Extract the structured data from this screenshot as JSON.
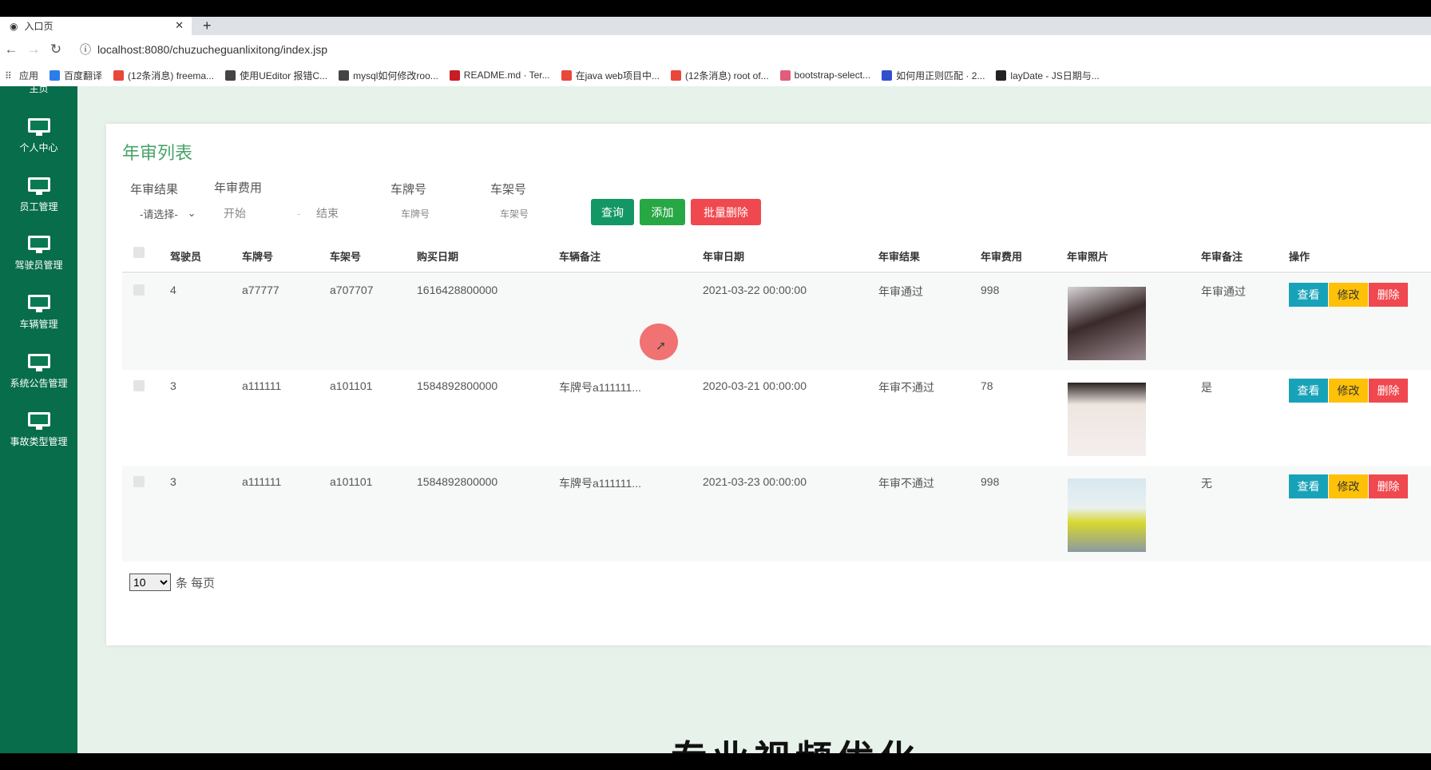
{
  "browser": {
    "tab_title": "入口页",
    "url": "localhost:8080/chuzucheguanlixitong/index.jsp",
    "bookmarks": [
      {
        "label": "应用",
        "color": "#555555"
      },
      {
        "label": "百度翻译",
        "color": "#2b7de9"
      },
      {
        "label": "(12条消息) freema...",
        "color": "#e8473a"
      },
      {
        "label": "使用UEditor 报错C...",
        "color": "#444444"
      },
      {
        "label": "mysql如何修改roo...",
        "color": "#444444"
      },
      {
        "label": "README.md · Ter...",
        "color": "#c71d23"
      },
      {
        "label": "在java web项目中...",
        "color": "#e8473a"
      },
      {
        "label": "(12条消息) root of...",
        "color": "#e8473a"
      },
      {
        "label": "bootstrap-select...",
        "color": "#e25c7c"
      },
      {
        "label": "如何用正则匹配 · 2...",
        "color": "#3050d0"
      },
      {
        "label": "layDate - JS日期与...",
        "color": "#222222"
      }
    ]
  },
  "sidebar": {
    "items": [
      {
        "label": "主页"
      },
      {
        "label": "个人中心"
      },
      {
        "label": "员工管理"
      },
      {
        "label": "驾驶员管理"
      },
      {
        "label": "车辆管理"
      },
      {
        "label": "系统公告管理"
      },
      {
        "label": "事故类型管理"
      }
    ]
  },
  "main": {
    "title": "年审列表",
    "filters": {
      "result_label": "年审结果",
      "result_value": "-请选择-",
      "fee_label": "年审费用",
      "fee_start_placeholder": "开始",
      "fee_sep": "-",
      "fee_end_placeholder": "结束",
      "plate_label": "车牌号",
      "plate_placeholder": "车牌号",
      "frame_label": "车架号",
      "frame_placeholder": "车架号"
    },
    "buttons": {
      "search": "查询",
      "add": "添加",
      "batch_delete": "批量删除"
    },
    "columns": [
      "驾驶员",
      "车牌号",
      "车架号",
      "购买日期",
      "车辆备注",
      "年审日期",
      "年审结果",
      "年审费用",
      "年审照片",
      "年审备注",
      "操作"
    ],
    "rows": [
      {
        "driver": "4",
        "plate": "a77777",
        "frame": "a707707",
        "buy_date": "1616428800000",
        "vehicle_note": "",
        "inspect_date": "2021-03-22 00:00:00",
        "result": "年审通过",
        "fee": "998",
        "note": "年审通过"
      },
      {
        "driver": "3",
        "plate": "a111111",
        "frame": "a101101",
        "buy_date": "1584892800000",
        "vehicle_note": "车牌号a111111...",
        "inspect_date": "2020-03-21 00:00:00",
        "result": "年审不通过",
        "fee": "78",
        "note": "是"
      },
      {
        "driver": "3",
        "plate": "a111111",
        "frame": "a101101",
        "buy_date": "1584892800000",
        "vehicle_note": "车牌号a111111...",
        "inspect_date": "2021-03-23 00:00:00",
        "result": "年审不通过",
        "fee": "998",
        "note": "无"
      }
    ],
    "row_actions": {
      "view": "查看",
      "edit": "修改",
      "delete": "删除"
    },
    "pagination": {
      "per_page": "10",
      "per_page_suffix": "条 每页"
    }
  },
  "overlay_caption": "专业视频优化",
  "colors": {
    "sidebar": "#076d4a",
    "title": "#4aa36a",
    "search": "#139865",
    "add": "#28a745",
    "danger": "#f0484f",
    "view": "#17a2b8",
    "edit": "#ffc107"
  }
}
